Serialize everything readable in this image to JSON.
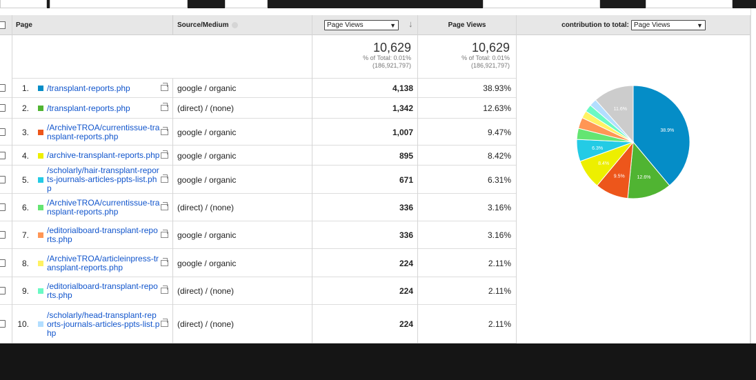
{
  "header": {
    "page_col": "Page",
    "source_col": "Source/Medium",
    "metric_select": "Page Views",
    "metric_col": "Page Views",
    "contribution_label": "contribution to total:",
    "contribution_select": "Page Views"
  },
  "totals": [
    {
      "value": "10,629",
      "pct": "% of Total: 0.01%",
      "of": "(186,921,797)"
    },
    {
      "value": "10,629",
      "pct": "% of Total: 0.01%",
      "of": "(186,921,797)"
    }
  ],
  "rows": [
    {
      "idx": "1.",
      "page": "/transplant-reports.php",
      "source": "google / organic",
      "views": "4,138",
      "pct": "38.93%",
      "color": "#058dc7"
    },
    {
      "idx": "2.",
      "page": "/transplant-reports.php",
      "source": "(direct) / (none)",
      "views": "1,342",
      "pct": "12.63%",
      "color": "#50b432"
    },
    {
      "idx": "3.",
      "page": "/ArchiveTROA/currentissue-transplant-reports.php",
      "source": "google / organic",
      "views": "1,007",
      "pct": "9.47%",
      "color": "#ed561b"
    },
    {
      "idx": "4.",
      "page": "/archive-transplant-reports.php",
      "source": "google / organic",
      "views": "895",
      "pct": "8.42%",
      "color": "#edef00"
    },
    {
      "idx": "5.",
      "page": "/scholarly/hair-transplant-reports-journals-articles-ppts-list.php",
      "source": "google / organic",
      "views": "671",
      "pct": "6.31%",
      "color": "#24cbe5"
    },
    {
      "idx": "6.",
      "page": "/ArchiveTROA/currentissue-transplant-reports.php",
      "source": "(direct) / (none)",
      "views": "336",
      "pct": "3.16%",
      "color": "#64e572"
    },
    {
      "idx": "7.",
      "page": "/editorialboard-transplant-reports.php",
      "source": "google / organic",
      "views": "336",
      "pct": "3.16%",
      "color": "#ff9655"
    },
    {
      "idx": "8.",
      "page": "/ArchiveTROA/articleinpress-transplant-reports.php",
      "source": "google / organic",
      "views": "224",
      "pct": "2.11%",
      "color": "#fff263"
    },
    {
      "idx": "9.",
      "page": "/editorialboard-transplant-reports.php",
      "source": "(direct) / (none)",
      "views": "224",
      "pct": "2.11%",
      "color": "#6af9c4"
    },
    {
      "idx": "10.",
      "page": "/scholarly/head-transplant-reports-journals-articles-ppts-list.php",
      "source": "(direct) / (none)",
      "views": "224",
      "pct": "2.11%",
      "color": "#b2deff"
    }
  ],
  "chart_data": {
    "type": "pie",
    "slices": [
      {
        "value": 38.93,
        "color": "#058dc7",
        "label": "38.9%"
      },
      {
        "value": 12.63,
        "color": "#50b432",
        "label": "12.6%"
      },
      {
        "value": 9.47,
        "color": "#ed561b",
        "label": "9.5%"
      },
      {
        "value": 8.42,
        "color": "#edef00",
        "label": "8.4%"
      },
      {
        "value": 6.31,
        "color": "#24cbe5",
        "label": "6.3%"
      },
      {
        "value": 3.16,
        "color": "#64e572",
        "label": ""
      },
      {
        "value": 3.16,
        "color": "#ff9655",
        "label": ""
      },
      {
        "value": 2.11,
        "color": "#fff263",
        "label": ""
      },
      {
        "value": 2.11,
        "color": "#6af9c4",
        "label": ""
      },
      {
        "value": 2.11,
        "color": "#b2deff",
        "label": ""
      },
      {
        "value": 11.59,
        "color": "#cccccc",
        "label": "11.6%"
      }
    ]
  }
}
